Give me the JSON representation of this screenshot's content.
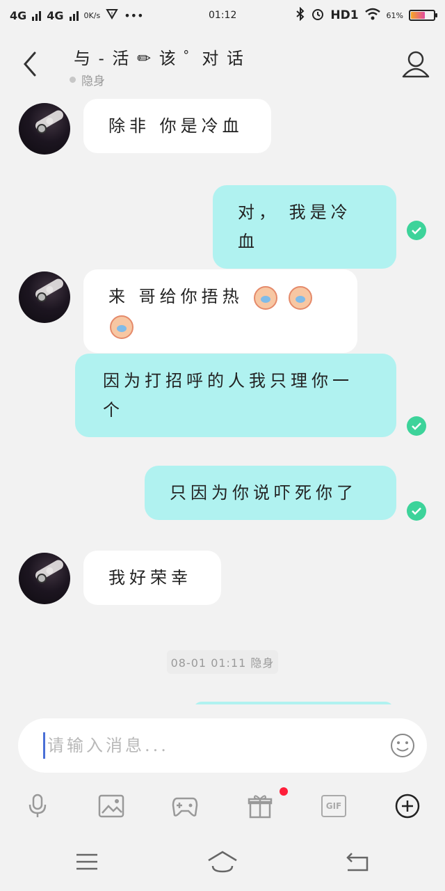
{
  "status_bar": {
    "network1": "4G",
    "network2": "4G",
    "net_speed": "0K/s",
    "time": "01:12",
    "hd": "HD1",
    "battery_pct": "61%",
    "battery_level": 0.61
  },
  "header": {
    "title": "与 - 活 ✏ 该 ゜对 话",
    "status": "隐身"
  },
  "messages": [
    {
      "dir": "in",
      "text": "除非 你是冷血"
    },
    {
      "dir": "out",
      "text": "对， 我是冷血"
    },
    {
      "dir": "in",
      "text": "来 哥给你捂热"
    },
    {
      "dir": "out",
      "text": "因为打招呼的人我只理你一个"
    },
    {
      "dir": "out",
      "text": "只因为你说吓死你了"
    },
    {
      "dir": "in",
      "text": "我好荣幸"
    }
  ],
  "timestamp": "08-01 01:11 隐身",
  "input": {
    "placeholder": "请输入消息..."
  },
  "icons": {
    "back": "chevron-left-icon",
    "profile": "user-icon",
    "emoji": "smiley-icon",
    "mic": "microphone-icon",
    "image": "image-icon",
    "game": "gamepad-icon",
    "gift": "gift-icon",
    "gif": "gif-icon",
    "add": "plus-circle-icon"
  },
  "toolbar": {
    "gif_label": "GIF"
  },
  "colors": {
    "outgoing_bubble": "#b0f2f0",
    "incoming_bubble": "#ffffff",
    "read_check": "#3dd39a",
    "badge_red": "#ff1f3a",
    "caret": "#4a6fd6"
  }
}
